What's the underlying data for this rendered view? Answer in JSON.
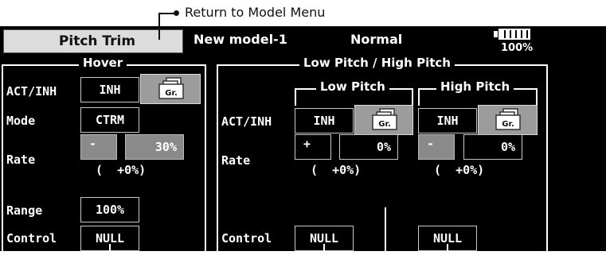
{
  "annotation": {
    "text": "Return to Model Menu"
  },
  "header": {
    "title_button": "Pitch Trim",
    "model_name": "New model-1",
    "condition": "Normal",
    "battery_percent": "100%",
    "battery_level": 1.0
  },
  "hover": {
    "frame_title": "Hover",
    "act_inh_label": "ACT/INH",
    "act_inh_value": "INH",
    "gr_label": "Gr.",
    "mode_label": "Mode",
    "mode_value": "CTRM",
    "rate_label": "Rate",
    "rate_sign": "-",
    "rate_value": "30%",
    "rate_trim": "(  +0%)",
    "range_label": "Range",
    "range_value": "100%",
    "control_label": "Control",
    "control_value": "NULL"
  },
  "low_high": {
    "frame_title": "Low Pitch / High Pitch",
    "act_inh_label": "ACT/INH",
    "rate_label": "Rate",
    "control_label": "Control",
    "low": {
      "title": "Low Pitch",
      "act_inh_value": "INH",
      "gr_label": "Gr.",
      "rate_sign": "+",
      "rate_value": "0%",
      "rate_trim": "(  +0%)",
      "control_value": "NULL"
    },
    "high": {
      "title": "High Pitch",
      "act_inh_value": "INH",
      "gr_label": "Gr.",
      "rate_sign": "-",
      "rate_value": "0%",
      "rate_trim": "(  +0%)",
      "control_value": "NULL"
    }
  }
}
